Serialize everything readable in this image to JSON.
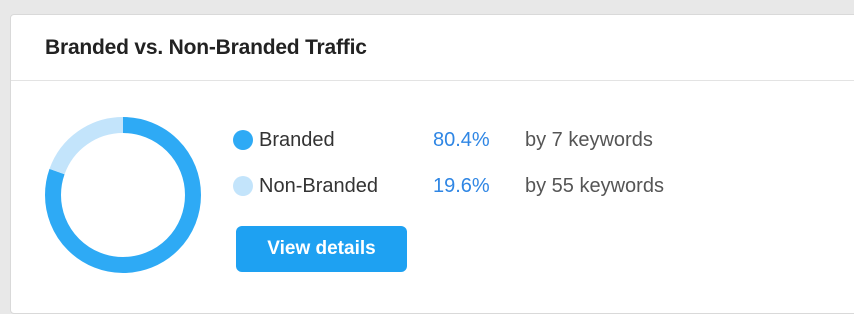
{
  "widget": {
    "title": "Branded vs. Non-Branded Traffic",
    "view_details_label": "View details"
  },
  "legend": [
    {
      "label": "Branded",
      "percent": "80.4%",
      "keywords": "by 7 keywords",
      "color": "#2eaaf5"
    },
    {
      "label": "Non-Branded",
      "percent": "19.6%",
      "keywords": "by 55 keywords",
      "color": "#c3e4fb"
    }
  ],
  "chart_data": {
    "type": "pie",
    "categories": [
      "Branded",
      "Non-Branded"
    ],
    "values": [
      80.4,
      19.6
    ],
    "colors": [
      "#2eaaf5",
      "#c3e4fb"
    ],
    "title": ""
  },
  "colors": {
    "accent": "#2eaaf5",
    "accent_light": "#c3e4fb",
    "percent_text": "#2f86e4",
    "button_bg": "#1ea1f2"
  }
}
